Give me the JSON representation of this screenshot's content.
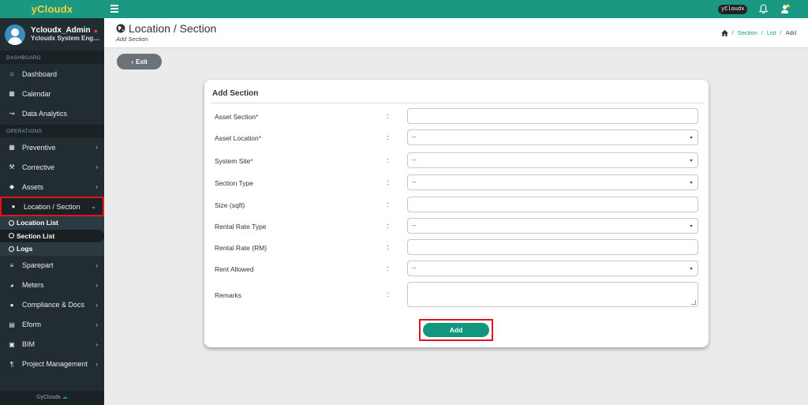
{
  "brand": {
    "name": "yCloudx"
  },
  "user": {
    "name": "Ycloudx_Admin",
    "status_dot": "●",
    "role": "Ycloudx System Engineer"
  },
  "sidebar": {
    "section_dashboard": "DASHBOARD",
    "section_operations": "OPERATIONS",
    "dashboard_items": [
      {
        "label": "Dashboard",
        "icon": "home-icon"
      },
      {
        "label": "Calendar",
        "icon": "calendar-icon"
      },
      {
        "label": "Data Analytics",
        "icon": "line-chart-icon"
      }
    ],
    "operations_items": [
      {
        "label": "Preventive",
        "icon": "calendar-check-icon"
      },
      {
        "label": "Corrective",
        "icon": "wrench-icon"
      },
      {
        "label": "Assets",
        "icon": "tag-icon"
      },
      {
        "label": "Location / Section",
        "icon": "globe-icon"
      }
    ],
    "submenu": [
      {
        "label": "Location List"
      },
      {
        "label": "Section List"
      },
      {
        "label": "Logs"
      }
    ],
    "more_items": [
      {
        "label": "Sparepart",
        "icon": "sliders-icon"
      },
      {
        "label": "Meters",
        "icon": "dashboard-icon"
      },
      {
        "label": "Compliance & Docs",
        "icon": "circle-icon"
      },
      {
        "label": "Eform",
        "icon": "file-icon"
      },
      {
        "label": "BIM",
        "icon": "cube-icon"
      },
      {
        "label": "Project Management",
        "icon": "paragraph-icon"
      }
    ],
    "footer": "©yCloudx"
  },
  "topbar": {
    "brand_pill": "yCloudx"
  },
  "header": {
    "title": "Location / Section",
    "subtitle": "Add Section",
    "breadcrumb": [
      "Section",
      "List",
      "Add"
    ]
  },
  "exit_label": "Exit",
  "form": {
    "title": "Add Section",
    "colon": ":",
    "fields": [
      {
        "label": "Asset Section",
        "required": true,
        "type": "text",
        "value": ""
      },
      {
        "label": "Asset Location",
        "required": true,
        "type": "select",
        "value": "--"
      },
      {
        "label": "System Site",
        "required": true,
        "type": "select",
        "value": "--"
      },
      {
        "label": "Section Type",
        "required": false,
        "type": "select",
        "value": "--"
      },
      {
        "label": "Size (sqft)",
        "required": false,
        "type": "text",
        "value": ""
      },
      {
        "label": "Rental Rate Type",
        "required": false,
        "type": "select",
        "value": "--"
      },
      {
        "label": "Rental Rate (RM)",
        "required": false,
        "type": "text",
        "value": ""
      },
      {
        "label": "Rent Allowed",
        "required": false,
        "type": "select",
        "value": "--"
      },
      {
        "label": "Remarks",
        "required": false,
        "type": "textarea",
        "value": ""
      }
    ],
    "required_mark": "*",
    "submit_label": "Add"
  },
  "colors": {
    "brand": "#1a9882",
    "sidebar": "#222d32",
    "highlight": "#e3121b",
    "button": "#12977f"
  }
}
